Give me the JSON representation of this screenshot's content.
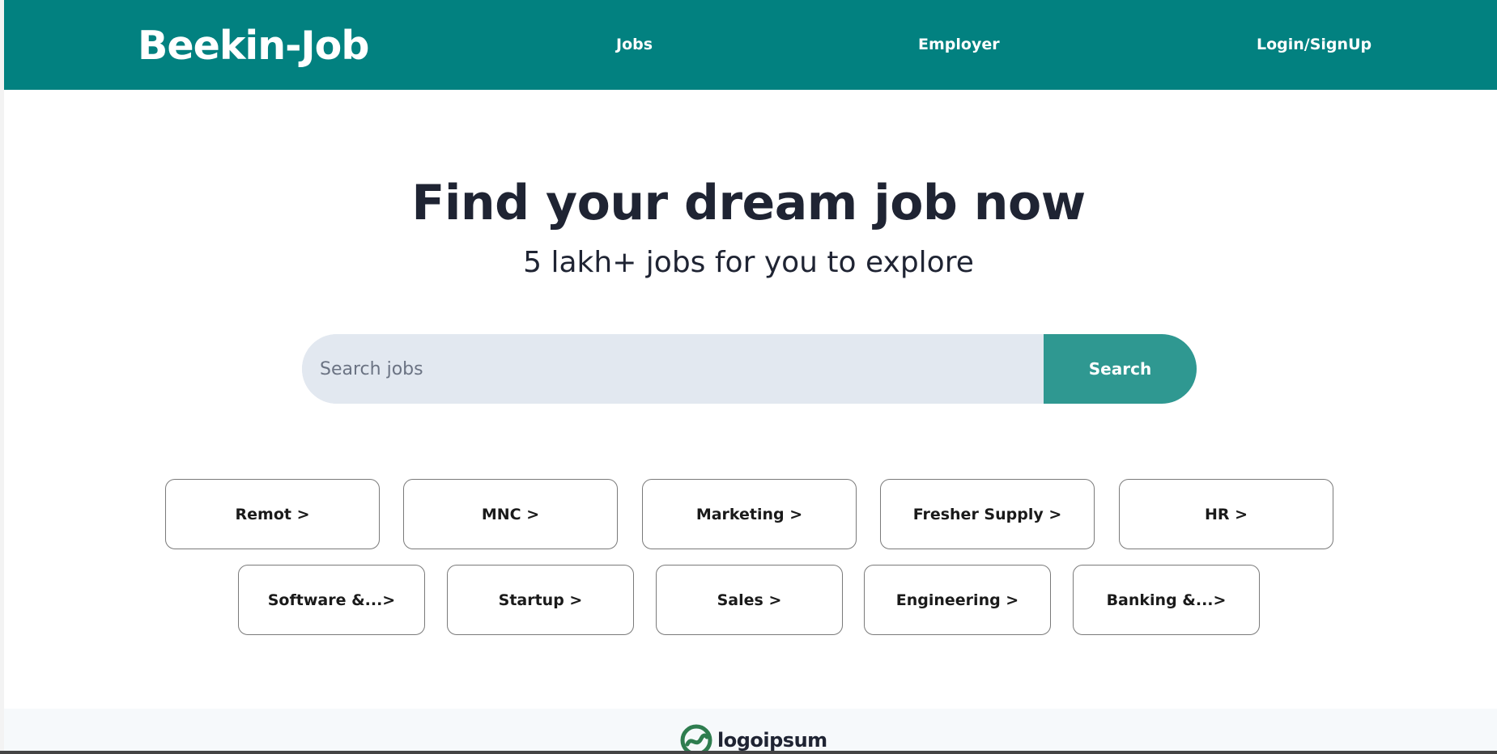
{
  "header": {
    "brand": "Beekin-Job",
    "nav": {
      "jobs": "Jobs",
      "employer": "Employer",
      "login": "Login/SignUp"
    }
  },
  "hero": {
    "title": "Find your dream job now",
    "subtitle": "5 lakh+ jobs for you to explore"
  },
  "search": {
    "placeholder": "Search jobs",
    "value": "",
    "button_label": "Search"
  },
  "categories": {
    "row1": [
      "Remot >",
      "MNC >",
      "Marketing >",
      "Fresher Supply >",
      "HR >"
    ],
    "row2": [
      "Software &...>",
      "Startup >",
      "Sales >",
      "Engineering >",
      "Banking &...>"
    ]
  },
  "footer": {
    "logo_text": "logoipsum",
    "logo_icon": "logoipsum-icon"
  },
  "colors": {
    "brand_teal": "#028180",
    "search_button": "#2f9891",
    "search_field": "#e2e8f0",
    "heading_text": "#1f2433",
    "logo_green": "#2e7d4f"
  }
}
